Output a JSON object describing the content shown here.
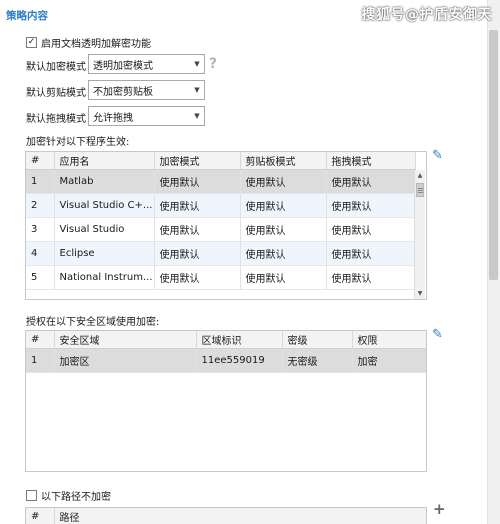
{
  "section_title": "策略内容",
  "watermark": "搜狐号@护盾安御天",
  "enable_checkbox": {
    "label": "启用文档透明加解密功能",
    "checked": true,
    "mark": "✓"
  },
  "settings": [
    {
      "label": "默认加密模式",
      "value": "透明加密模式"
    },
    {
      "label": "默认剪贴模式",
      "value": "不加密剪贴板"
    },
    {
      "label": "默认拖拽模式",
      "value": "允许拖拽"
    }
  ],
  "help_glyph": "?",
  "apps_section": {
    "label": "加密针对以下程序生效:",
    "columns": [
      "#",
      "应用名",
      "加密模式",
      "剪贴板模式",
      "拖拽模式"
    ],
    "rows": [
      [
        "1",
        "Matlab",
        "使用默认",
        "使用默认",
        "使用默认"
      ],
      [
        "2",
        "Visual Studio C+...",
        "使用默认",
        "使用默认",
        "使用默认"
      ],
      [
        "3",
        "Visual Studio",
        "使用默认",
        "使用默认",
        "使用默认"
      ],
      [
        "4",
        "Eclipse",
        "使用默认",
        "使用默认",
        "使用默认"
      ],
      [
        "5",
        "National Instrum...",
        "使用默认",
        "使用默认",
        "使用默认"
      ]
    ]
  },
  "zones_section": {
    "label": "授权在以下安全区域使用加密:",
    "columns": [
      "#",
      "安全区域",
      "区域标识",
      "密级",
      "权限"
    ],
    "rows": [
      [
        "1",
        "加密区",
        "11ee559019",
        "无密级",
        "加密"
      ]
    ]
  },
  "exclude_section": {
    "label": "以下路径不加密",
    "checked": false,
    "columns": [
      "#",
      "路径"
    ]
  },
  "icons": {
    "edit": "✎",
    "add": "+",
    "up": "▲",
    "down": "▼",
    "dropdown": "▼"
  }
}
